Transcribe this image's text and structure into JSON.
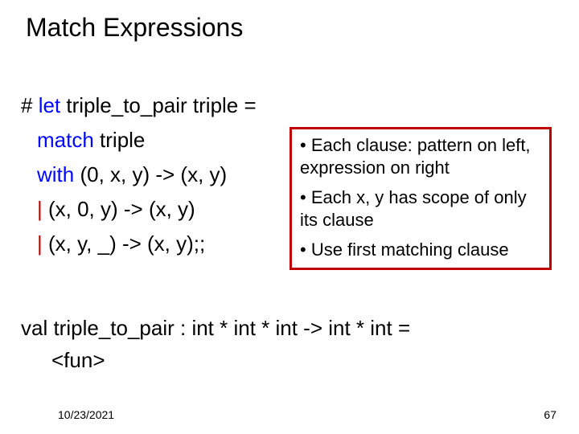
{
  "title": "Match Expressions",
  "code": {
    "line1_pre": "# ",
    "line1_kw": "let",
    "line1_rest": " triple_to_pair triple =",
    "line2_kw": "match",
    "line2_rest": " triple",
    "line3_kw": "with",
    "line3_rest": " (0, x, y) -> (x, y)",
    "line4_bar": "|",
    "line4_rest": " (x, 0, y) -> (x, y)",
    "line5_bar": "|",
    "line5_rest": " (x, y, _) -> (x, y);;"
  },
  "box": {
    "b1": "• Each clause: pattern on left, expression on right",
    "b2": "• Each x, y has scope of only its clause",
    "b3": "• Use first matching clause"
  },
  "val": {
    "line1": "val triple_to_pair : int * int * int -> int * int =",
    "line2": "<fun>"
  },
  "footer": {
    "date": "10/23/2021",
    "page": "67"
  }
}
